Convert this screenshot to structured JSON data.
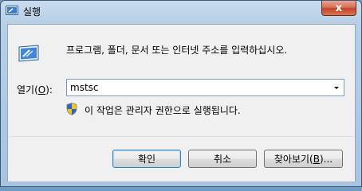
{
  "window": {
    "title": "실행",
    "close_label": "x"
  },
  "dialog": {
    "prompt": "프로그램, 폴더, 문서 또는 인터넷 주소를 입력하십시오.",
    "open_label_prefix": "열기(",
    "open_label_accel": "O",
    "open_label_suffix": "):",
    "open_value": "mstsc",
    "admin_note": "이 작업은 관리자 권한으로 실행됩니다."
  },
  "buttons": {
    "ok": "확인",
    "cancel": "취소",
    "browse_prefix": "찾아보기(",
    "browse_accel": "B",
    "browse_suffix": ")..."
  },
  "icons": {
    "title": "run-app-icon",
    "dialog": "run-app-icon",
    "shield": "uac-shield-icon",
    "dropdown": "chevron-down-icon"
  }
}
